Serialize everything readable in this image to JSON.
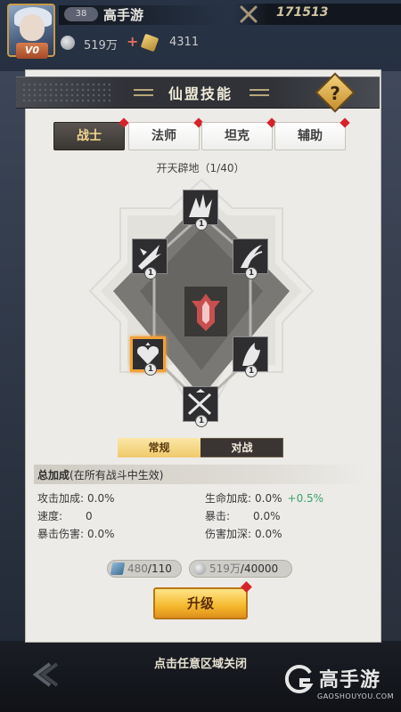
{
  "player": {
    "level": "38",
    "name": "高手游",
    "vip": "V0",
    "power": "171513",
    "silver": "519万",
    "gold": "4311"
  },
  "panel": {
    "title": "仙盟技能",
    "help": "?"
  },
  "tabs": [
    {
      "label": "战士",
      "active": true
    },
    {
      "label": "法师",
      "active": false
    },
    {
      "label": "坦克",
      "active": false
    },
    {
      "label": "辅助",
      "active": false
    }
  ],
  "skill_tree": {
    "title": "开天辟地（1/40）",
    "nodes": [
      {
        "id": "top",
        "level": "1"
      },
      {
        "id": "upper-left",
        "level": "1"
      },
      {
        "id": "upper-right",
        "level": "1"
      },
      {
        "id": "lower-left",
        "level": "1",
        "selected": true
      },
      {
        "id": "lower-right",
        "level": "1"
      },
      {
        "id": "bottom",
        "level": "1"
      }
    ]
  },
  "mode": {
    "normal": "常规",
    "battle": "对战"
  },
  "stats": {
    "title": "总加成",
    "subtitle": "(在所有战斗中生效)",
    "attack_label": "攻击加成:",
    "attack_value": "0.0%",
    "life_label": "生命加成:",
    "life_value": "0.0%",
    "life_bonus": "+0.5%",
    "speed_label": "速度:",
    "speed_value": "0",
    "crit_label": "暴击:",
    "crit_value": "0.0%",
    "crit_dmg_label": "暴击伤害:",
    "crit_dmg_value": "0.0%",
    "dmg_deep_label": "伤害加深:",
    "dmg_deep_value": "0.0%"
  },
  "cost": {
    "book_have": "480",
    "book_need": "/110",
    "coin_have": "519万",
    "coin_need": "/40000"
  },
  "upgrade_label": "升级",
  "close_hint": "点击任意区域关闭",
  "watermark": {
    "name": "高手游",
    "domain": "GAOSHOUYOU.COM"
  },
  "colors": {
    "accent_gold": "#f0a13a",
    "bonus_green": "#3aa36a",
    "alert_red": "#d8222a"
  }
}
